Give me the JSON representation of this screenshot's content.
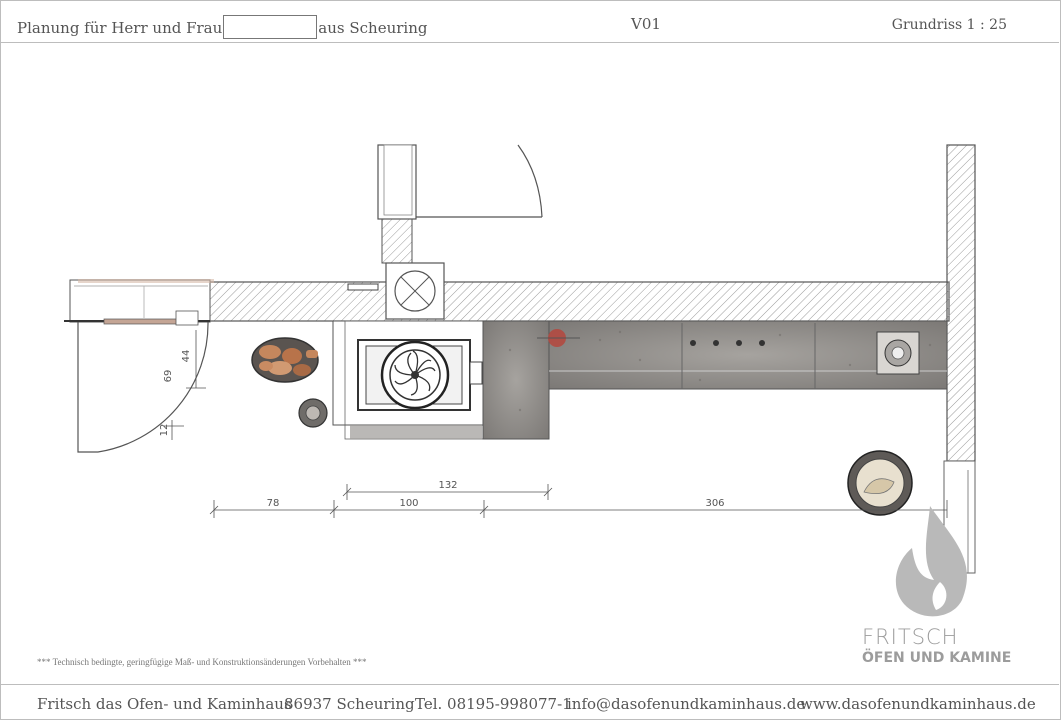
{
  "header": {
    "title_prefix": "Planung für Herr und Frau",
    "title_suffix": "aus Scheuring",
    "version": "V01",
    "scale": "Grundriss 1 : 25"
  },
  "dimensions": {
    "d69": "69",
    "d44": "44",
    "d12": "12",
    "d78": "78",
    "d100": "100",
    "d132": "132",
    "d306": "306"
  },
  "note": "***   Technisch bedingte, geringfügige Maß- und Konstruktionsänderungen Vorbehalten   ***",
  "logo": {
    "line1": "FRITSCH",
    "line2": "ÖFEN UND KAMINE"
  },
  "footer": {
    "company": "Fritsch das Ofen- und Kaminhaus",
    "city": "86937 Scheuring",
    "phone": "Tel. 08195-998077-1",
    "email": "info@dasofenundkaminhaus.de",
    "web": "www.dasofenundkaminhaus.de"
  },
  "colors": {
    "wall_hatch": "#8a8a8a",
    "stone": "#8d8d8d",
    "accent_red": "#b5473d",
    "wood": "#b07850"
  }
}
